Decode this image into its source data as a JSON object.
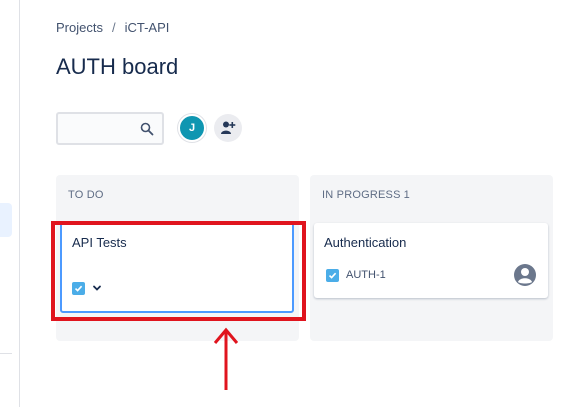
{
  "breadcrumb": {
    "project_root": "Projects",
    "separator": "/",
    "project": "iCT-API"
  },
  "page": {
    "title": "AUTH board"
  },
  "search": {
    "placeholder": "",
    "value": ""
  },
  "avatar": {
    "initial": "J"
  },
  "columns": [
    {
      "name": "TO DO",
      "count": "",
      "cards": [
        {
          "title": "API Tests",
          "key": ""
        }
      ]
    },
    {
      "name": "IN PROGRESS",
      "count": "1",
      "cards": [
        {
          "title": "Authentication",
          "key": "AUTH-1"
        }
      ]
    }
  ],
  "colors": {
    "highlight": "#e0141e",
    "card_focus_border": "#4c9aff",
    "checkbox": "#4bade8",
    "avatar_bg": "#0f96b1",
    "column_bg": "#f4f5f7"
  },
  "icons": [
    "search-icon",
    "add-people-icon",
    "checkbox-icon",
    "chevron-down-icon",
    "assignee-icon",
    "up-arrow-icon"
  ]
}
